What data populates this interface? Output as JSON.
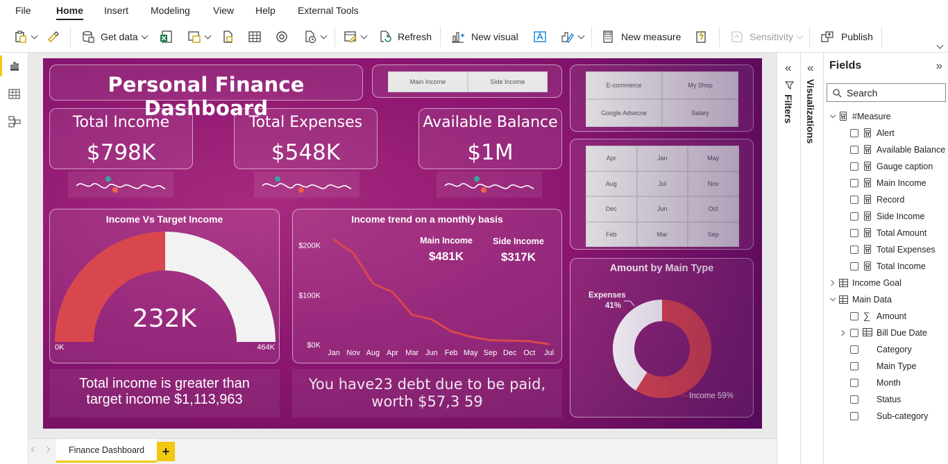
{
  "menu": {
    "items": [
      "File",
      "Home",
      "Insert",
      "Modeling",
      "View",
      "Help",
      "External Tools"
    ],
    "active": "Home"
  },
  "ribbon": {
    "get_data": "Get data",
    "refresh": "Refresh",
    "new_visual": "New visual",
    "new_measure": "New measure",
    "sensitivity": "Sensitivity",
    "publish": "Publish"
  },
  "dashboard": {
    "title": "Personal Finance Dashboard",
    "income_slicer": [
      "Main Income",
      "Side Income"
    ],
    "source_slicer": [
      "E-commerce",
      "My Shop",
      "Google Adsecne",
      "Salary"
    ],
    "month_slicer": [
      "Apr",
      "Jan",
      "May",
      "Aug",
      "Jul",
      "Nov",
      "Dec",
      "Jun",
      "Oct",
      "Feb",
      "Mar",
      "Sep"
    ],
    "kpis": [
      {
        "title": "Total Income",
        "value": "$798K"
      },
      {
        "title": "Total Expenses",
        "value": "$548K"
      },
      {
        "title": "Available Balance",
        "value": "$1M"
      }
    ],
    "gauge": {
      "title": "Income Vs Target Income",
      "value_label": "232K",
      "min_label": "0K",
      "max_label": "464K",
      "value": 232,
      "max": 464,
      "fill_color": "#d9474e",
      "rest_color": "#f2f2f2"
    },
    "gauge_message": {
      "line1": "Total income is greater than",
      "line2": "target income $1,113,963"
    },
    "trend": {
      "title": "Income trend on a monthly basis",
      "main_income_label": "Main Income",
      "main_income_value": "$481K",
      "side_income_label": "Side Income",
      "side_income_value": "$317K"
    },
    "debt_message": {
      "line1": "You have23 debt  due to be paid,",
      "line2": "worth $57,3 59"
    },
    "donut": {
      "title": "Amount by Main Type",
      "expenses_label": "Expenses",
      "expenses_pct": "41%",
      "income_label": "Income 59%"
    }
  },
  "chart_data": [
    {
      "type": "line",
      "title": "Income trend on a monthly basis",
      "x": [
        "Jan",
        "Nov",
        "Aug",
        "Apr",
        "Mar",
        "Jun",
        "Feb",
        "May",
        "Sep",
        "Dec",
        "Oct",
        "Jul"
      ],
      "series": [
        {
          "values": [
            211,
            184,
            123,
            106,
            60,
            51,
            27,
            16,
            9,
            8,
            7,
            1
          ]
        }
      ],
      "yticks": [
        "$0K",
        "$100K",
        "$200K"
      ],
      "ylim": [
        0,
        230
      ],
      "line_color": "#d9474e"
    },
    {
      "type": "pie",
      "title": "Amount by Main Type",
      "categories": [
        "Income",
        "Expenses"
      ],
      "values": [
        59,
        41
      ],
      "colors": [
        "#d9474e",
        "#ffffff"
      ]
    }
  ],
  "panes": {
    "filters": "Filters",
    "visualizations": "Visualizations",
    "fields": "Fields",
    "search_placeholder": "Search"
  },
  "fields": {
    "tables": [
      {
        "name": "#Measure",
        "items": [
          "Alert",
          "Available Balance",
          "Gauge caption",
          "Main Income",
          "Record",
          "Side Income",
          "Total Amount",
          "Total Expenses",
          "Total Income"
        ]
      },
      {
        "name": "Income Goal"
      },
      {
        "name": "Main Data",
        "items": [
          "Amount",
          "Bill Due Date",
          "Category",
          "Main Type",
          "Month",
          "Status",
          "Sub-category"
        ]
      }
    ]
  },
  "page_tab": "Finance Dashboard"
}
